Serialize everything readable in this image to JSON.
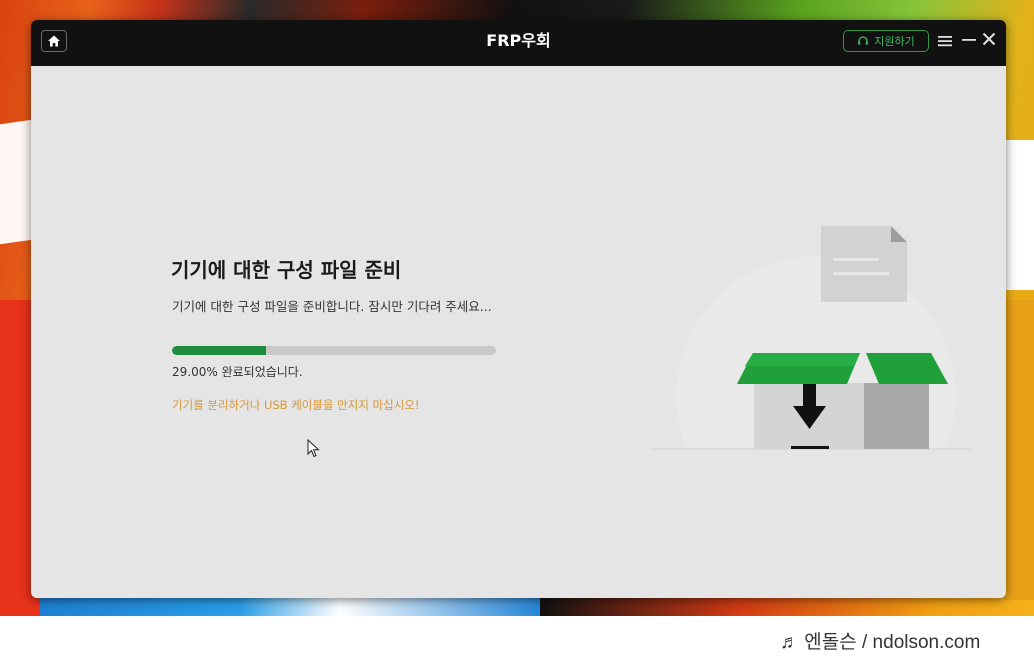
{
  "window": {
    "title": "FRP우회",
    "support_label": "지원하기"
  },
  "main": {
    "heading": "기기에 대한 구성 파일 준비",
    "description": "기기에 대한 구성 파일을 준비합니다. 잠시만 기다려 주세요...",
    "progress_percent": 29,
    "progress_text": "29.00% 완료되었습니다.",
    "warning": "기기를 분리하거나 USB 케이블을 만지지 마십시오!"
  },
  "icons": {
    "home": "home-icon",
    "support": "headset-icon",
    "menu": "hamburger-menu-icon",
    "minimize": "minimize-icon",
    "close": "close-icon",
    "illustration": "box-download-illustration"
  },
  "colors": {
    "titlebar": "#111111",
    "window_bg": "#e5e5e5",
    "accent_green": "#1f8b3d",
    "support_green": "#3cc060",
    "progress_track": "#c8c8c8",
    "warning": "#d99636"
  },
  "footer": {
    "watermark": "♬ 엔돌슨 / ndolson.com"
  }
}
